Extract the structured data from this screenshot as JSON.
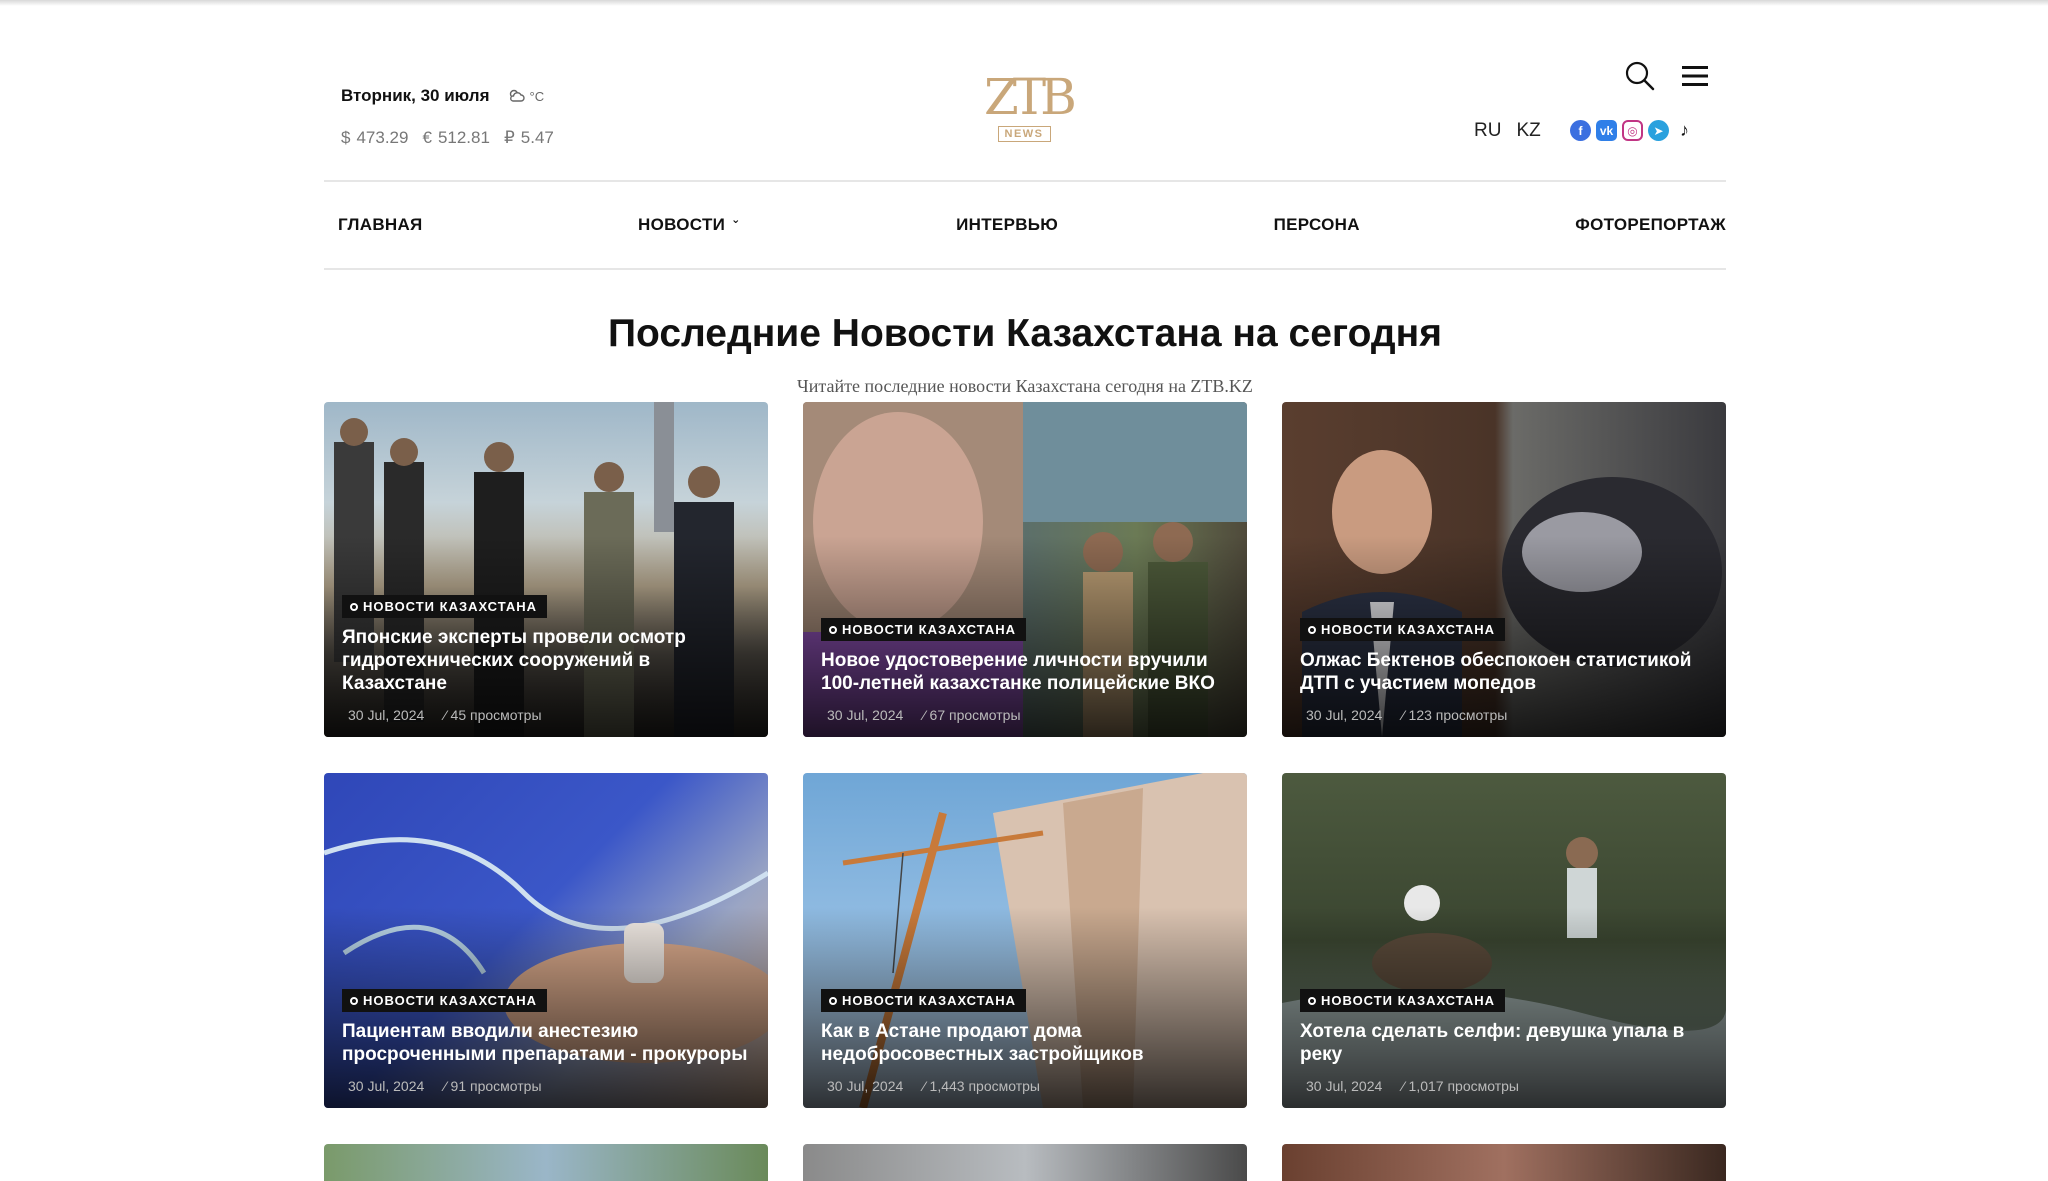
{
  "header": {
    "date": "Вторник, 30 июля",
    "weather_unit": "°C",
    "rates": [
      {
        "symbol": "$",
        "value": "473.29"
      },
      {
        "symbol": "€",
        "value": "512.81"
      },
      {
        "symbol": "₽",
        "value": "5.47"
      }
    ],
    "logo_mark": "ZTB",
    "logo_sub": "NEWS",
    "languages": [
      "RU",
      "KZ"
    ],
    "socials": [
      "facebook-icon",
      "vk-icon",
      "instagram-icon",
      "telegram-icon",
      "tiktok-icon"
    ]
  },
  "nav": [
    {
      "label": "ГЛАВНАЯ"
    },
    {
      "label": "НОВОСТИ"
    },
    {
      "label": "ИНТЕРВЬЮ"
    },
    {
      "label": "ПЕРСОНА"
    },
    {
      "label": "ФОТОРЕПОРТАЖ"
    }
  ],
  "main": {
    "title": "Последние Новости Казахстана на сегодня",
    "subtitle": "Читайте последние новости Казахстана сегодня на ZTB.KZ"
  },
  "articles": [
    {
      "category": "НОВОСТИ КАЗАХСТАНА",
      "title": "Японские эксперты провели осмотр гидротехнических сооружений в Казахстане",
      "date": "30 Jul, 2024",
      "views": "45 просмотры"
    },
    {
      "category": "НОВОСТИ КАЗАХСТАНА",
      "title": "Новое удостоверение личности вручили 100-летней казахстанке полицейские ВКО",
      "date": "30 Jul, 2024",
      "views": "67 просмотры"
    },
    {
      "category": "НОВОСТИ КАЗАХСТАНА",
      "title": "Олжас Бектенов обеспокоен статистикой ДТП с участием мопедов",
      "date": "30 Jul, 2024",
      "views": "123 просмотры"
    },
    {
      "category": "НОВОСТИ КАЗАХСТАНА",
      "title": "Пациентам вводили анестезию просроченными препаратами - прокуроры",
      "date": "30 Jul, 2024",
      "views": "91 просмотры"
    },
    {
      "category": "НОВОСТИ КАЗАХСТАНА",
      "title": "Как в Астане продают дома недобросовестных застройщиков",
      "date": "30 Jul, 2024",
      "views": "1,443 просмотры"
    },
    {
      "category": "НОВОСТИ КАЗАХСТАНА",
      "title": "Хотела сделать селфи: девушка упала в реку",
      "date": "30 Jul, 2024",
      "views": "1,017 просмотры"
    }
  ],
  "colors": {
    "brand_gold": "#c9a77a",
    "badge_bg": "#111111"
  }
}
